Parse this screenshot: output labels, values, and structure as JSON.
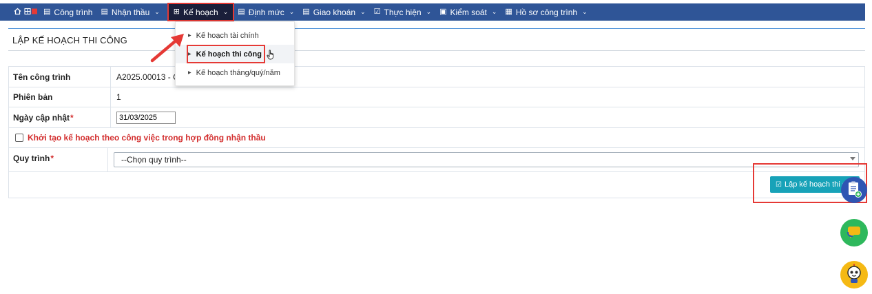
{
  "nav": {
    "items": [
      {
        "label": "Công trình",
        "icon": "list-icon"
      },
      {
        "label": "Nhận thầu",
        "icon": "doc-icon"
      },
      {
        "label": "Kế hoạch",
        "icon": "grid-icon"
      },
      {
        "label": "Định mức",
        "icon": "doc-icon"
      },
      {
        "label": "Giao khoán",
        "icon": "doc-icon"
      },
      {
        "label": "Thực hiện",
        "icon": "check-icon"
      },
      {
        "label": "Kiểm soát",
        "icon": "monitor-icon"
      },
      {
        "label": "Hồ sơ công trình",
        "icon": "briefcase-icon"
      }
    ]
  },
  "dropdown": {
    "items": [
      {
        "label": "Kế hoạch tài chính"
      },
      {
        "label": "Kế hoạch thi công"
      },
      {
        "label": "Kế hoạch tháng/quý/năm"
      }
    ]
  },
  "page": {
    "title": "LẬP KẾ HOẠCH THI CÔNG"
  },
  "form": {
    "project_label": "Tên công trình",
    "project_value": "A2025.00013 - C",
    "version_label": "Phiên bản",
    "version_value": "1",
    "date_label": "Ngày cập nhật",
    "date_value": "31/03/2025",
    "checkbox_label": "Khởi tạo kế hoạch theo công việc trong hợp đồng nhận thầu",
    "process_label": "Quy trình",
    "process_placeholder": "--Chọn quy trình--",
    "required_mark": "*"
  },
  "actions": {
    "submit_label": "Lập kế hoạch thi c"
  },
  "colors": {
    "nav_bg": "#2f5597",
    "accent_red": "#e53935",
    "button_teal": "#17a2b8"
  }
}
